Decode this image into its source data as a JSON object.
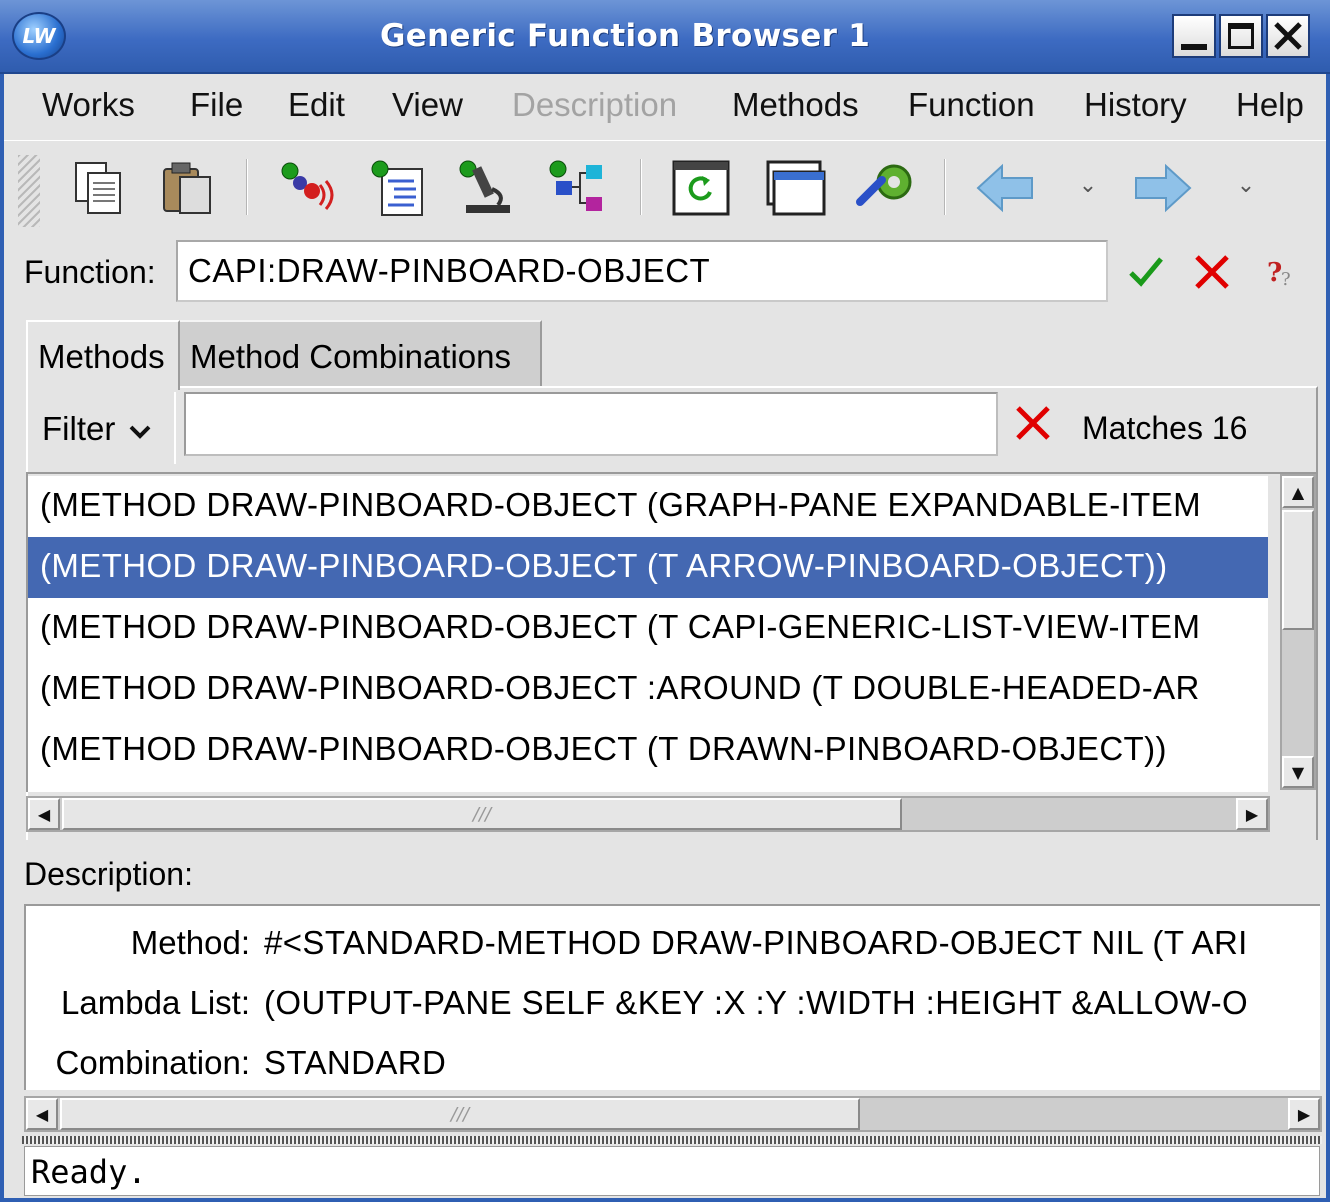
{
  "window": {
    "title": "Generic Function Browser 1",
    "app_icon_text": "LW"
  },
  "menubar": {
    "items": [
      {
        "label": "Works",
        "enabled": true
      },
      {
        "label": "File",
        "enabled": true
      },
      {
        "label": "Edit",
        "enabled": true
      },
      {
        "label": "View",
        "enabled": true
      },
      {
        "label": "Description",
        "enabled": false
      },
      {
        "label": "Methods",
        "enabled": true
      },
      {
        "label": "Function",
        "enabled": true
      },
      {
        "label": "History",
        "enabled": true
      },
      {
        "label": "Help",
        "enabled": true
      }
    ]
  },
  "toolbar": {
    "buttons": [
      "copy-icon",
      "paste-icon",
      "inspect-icon",
      "class-browser-icon",
      "microscope-icon",
      "class-hierarchy-icon",
      "refresh-icon",
      "window-icon",
      "tools-icon",
      "back-arrow-icon",
      "forward-arrow-icon"
    ]
  },
  "function": {
    "label": "Function:",
    "value": "CAPI:DRAW-PINBOARD-OBJECT"
  },
  "tabs": {
    "methods": "Methods",
    "combinations": "Method Combinations"
  },
  "filter": {
    "label": "Filter",
    "value": "",
    "matches": "Matches 16"
  },
  "methods_list": [
    "(METHOD DRAW-PINBOARD-OBJECT (GRAPH-PANE EXPANDABLE-ITEM",
    "(METHOD DRAW-PINBOARD-OBJECT (T ARROW-PINBOARD-OBJECT))",
    "(METHOD DRAW-PINBOARD-OBJECT (T CAPI-GENERIC-LIST-VIEW-ITEM",
    "(METHOD DRAW-PINBOARD-OBJECT :AROUND (T DOUBLE-HEADED-AR",
    "(METHOD DRAW-PINBOARD-OBJECT (T DRAWN-PINBOARD-OBJECT))"
  ],
  "selected_index": 1,
  "description": {
    "label": "Description:",
    "method_key": "Method:",
    "method_value": "#<STANDARD-METHOD DRAW-PINBOARD-OBJECT NIL (T ARI",
    "lambda_key": "Lambda List:",
    "lambda_value": "(OUTPUT-PANE SELF &KEY :X :Y :WIDTH :HEIGHT &ALLOW-O",
    "combination_key": "Combination:",
    "combination_value": "STANDARD"
  },
  "status": {
    "text": "Ready."
  },
  "colors": {
    "titlebar": "#3d6bc2",
    "selection": "#4468b2",
    "accept_check": "#1a9a1a",
    "reject_x": "#e00000"
  }
}
